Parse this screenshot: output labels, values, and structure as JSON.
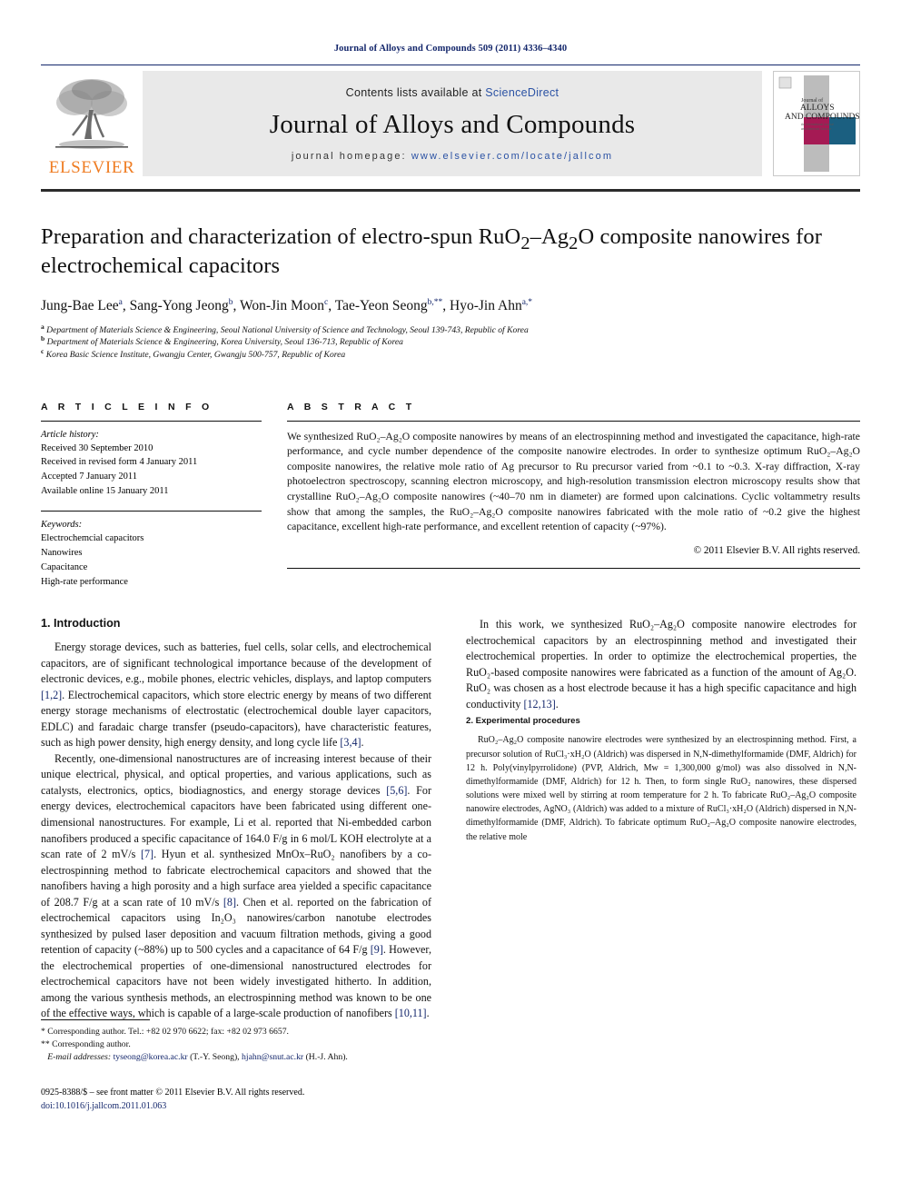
{
  "running_head": "Journal of Alloys and Compounds 509 (2011) 4336–4340",
  "masthead": {
    "contents_prefix": "Contents lists available at ",
    "sciencedirect": "ScienceDirect",
    "journal_name": "Journal of Alloys and Compounds",
    "homepage_label": "journal homepage: ",
    "homepage_url": "www.elsevier.com/locate/jallcom",
    "publisher_wordmark": "ELSEVIER",
    "cover": {
      "line1": "Journal of",
      "line2": "ALLOYS",
      "line3": "AND COMPOUNDS",
      "sub": "An International Journal\nand Materials Science",
      "accent_magenta": "#a51a54",
      "accent_teal": "#1b5f80",
      "accent_gray": "#bcbcbc"
    },
    "link_color": "#2b52a4"
  },
  "article": {
    "title": "Preparation and characterization of electro-spun RuO₂–Ag₂O composite nanowires for electrochemical capacitors",
    "title_line1_a": "Preparation and characterization of electro-spun RuO",
    "title_line1_b": "–Ag",
    "title_line1_c": "O composite",
    "title_line2": "nanowires for electrochemical capacitors",
    "authors_plain": "Jung-Bae Lee a, Sang-Yong Jeong b, Won-Jin Moon c, Tae-Yeon Seong b,**, Hyo-Jin Ahn a,*",
    "authors": [
      {
        "name": "Jung-Bae Lee",
        "marks": "a"
      },
      {
        "name": "Sang-Yong Jeong",
        "marks": "b"
      },
      {
        "name": "Won-Jin Moon",
        "marks": "c"
      },
      {
        "name": "Tae-Yeon Seong",
        "marks": "b,**"
      },
      {
        "name": "Hyo-Jin Ahn",
        "marks": "a,*"
      }
    ],
    "affiliations": [
      {
        "mark": "a",
        "text": "Department of Materials Science & Engineering, Seoul National University of Science and Technology, Seoul 139-743, Republic of Korea"
      },
      {
        "mark": "b",
        "text": "Department of Materials Science & Engineering, Korea University, Seoul 136-713, Republic of Korea"
      },
      {
        "mark": "c",
        "text": "Korea Basic Science Institute, Gwangju Center, Gwangju 500-757, Republic of Korea"
      }
    ]
  },
  "article_info": {
    "heading": "A R T I C L E   I N F O",
    "history_label": "Article history:",
    "history": [
      "Received 30 September 2010",
      "Received in revised form 4 January 2011",
      "Accepted 7 January 2011",
      "Available online 15 January 2011"
    ],
    "keywords_label": "Keywords:",
    "keywords": [
      "Electrochemcial capacitors",
      "Nanowires",
      "Capacitance",
      "High-rate performance"
    ]
  },
  "abstract": {
    "heading": "A B S T R A C T",
    "text": "We synthesized RuO₂–Ag₂O composite nanowires by means of an electrospinning method and investigated the capacitance, high-rate performance, and cycle number dependence of the composite nanowire electrodes. In order to synthesize optimum RuO₂–Ag₂O composite nanowires, the relative mole ratio of Ag precursor to Ru precursor varied from ~0.1 to ~0.3. X-ray diffraction, X-ray photoelectron spectroscopy, scanning electron microscopy, and high-resolution transmission electron microscopy results show that crystalline RuO₂–Ag₂O composite nanowires (~40–70 nm in diameter) are formed upon calcinations. Cyclic voltammetry results show that among the samples, the RuO₂–Ag₂O composite nanowires fabricated with the mole ratio of ~0.2 give the highest capacitance, excellent high-rate performance, and excellent retention of capacity (~97%).",
    "copyright": "© 2011 Elsevier B.V. All rights reserved."
  },
  "sections": {
    "introduction_heading": "1.  Introduction",
    "intro_p1": "Energy storage devices, such as batteries, fuel cells, solar cells, and electrochemical capacitors, are of significant technological importance because of the development of electronic devices, e.g., mobile phones, electric vehicles, displays, and laptop computers [1,2]. Electrochemical capacitors, which store electric energy by means of two different energy storage mechanisms of electrostatic (electrochemical double layer capacitors, EDLC) and faradaic charge transfer (pseudo-capacitors), have characteristic features, such as high power density, high energy density, and long cycle life [3,4].",
    "intro_p2": "Recently, one-dimensional nanostructures are of increasing interest because of their unique electrical, physical, and optical properties, and various applications, such as catalysts, electronics, optics, biodiagnostics, and energy storage devices [5,6]. For energy devices, electrochemical capacitors have been fabricated using different one-dimensional nanostructures. For example, Li et al. reported that Ni-embedded carbon nanofibers produced a specific capacitance of 164.0 F/g in 6 mol/L KOH electrolyte at a scan rate of 2 mV/s [7]. Hyun et al. synthesized MnOx–RuO₂ nanofibers by a co-electrospinning method to fabricate electrochemical capacitors and showed that the nanofibers having a high porosity and a high surface area yielded a specific capacitance of 208.7 F/g at a scan rate of 10 mV/s [8]. Chen et al. reported on the fabrication of electrochemical capacitors using In₂O₃ nanowires/carbon nanotube electrodes synthesized by pulsed laser deposition and vacuum filtration methods, giving a good retention of capacity (~88%) up to 500 cycles and a capacitance of 64 F/g [9]. However, the electrochemical properties of one-dimensional nanostructured electrodes for electrochemical capacitors have not been widely investigated hitherto. In addition, among the various synthesis methods, an electrospinning method was known to be one of the effective ways, which is capable of a large-scale production of nanofibers [10,11].",
    "intro_p3": "In this work, we synthesized RuO₂–Ag₂O composite nanowire electrodes for electrochemical capacitors by an electrospinning method and investigated their electrochemical properties. In order to optimize the electrochemical properties, the RuO₂-based composite nanowires were fabricated as a function of the amount of Ag₂O. RuO₂ was chosen as a host electrode because it has a high specific capacitance and high conductivity [12,13].",
    "experimental_heading": "2.  Experimental procedures",
    "exp_p1": "RuO₂–Ag₂O composite nanowire electrodes were synthesized by an electrospinning method. First, a precursor solution of RuCl₃·xH₂O (Aldrich) was dispersed in N,N-dimethylformamide (DMF, Aldrich) for 12 h. Poly(vinylpyrrolidone) (PVP, Aldrich, Mw = 1,300,000 g/mol) was also dissolved in N,N-dimethylformamide (DMF, Aldrich) for 12 h. Then, to form single RuO₂ nanowires, these dispersed solutions were mixed well by stirring at room temperature for 2 h. To fabricate RuO₂–Ag₂O composite nanowire electrodes, AgNO₃ (Aldrich) was added to a mixture of RuCl₃·xH₂O (Aldrich) dispersed in N,N-dimethylformamide (DMF, Aldrich). To fabricate optimum RuO₂–Ag₂O composite nanowire electrodes, the relative mole"
  },
  "footnotes": {
    "note1": "* Corresponding author. Tel.: +82 02 970 6622; fax: +82 02 973 6657.",
    "note2": "** Corresponding author.",
    "email_label": "E-mail addresses:",
    "email1": "tyseong@korea.ac.kr",
    "email1_person": "(T.-Y. Seong),",
    "email2": "hjahn@snut.ac.kr",
    "email2_person": "(H.-J. Ahn).",
    "imprint": "0925-8388/$ – see front matter © 2011 Elsevier B.V. All rights reserved.",
    "doi": "doi:10.1016/j.jallcom.2011.01.063"
  }
}
